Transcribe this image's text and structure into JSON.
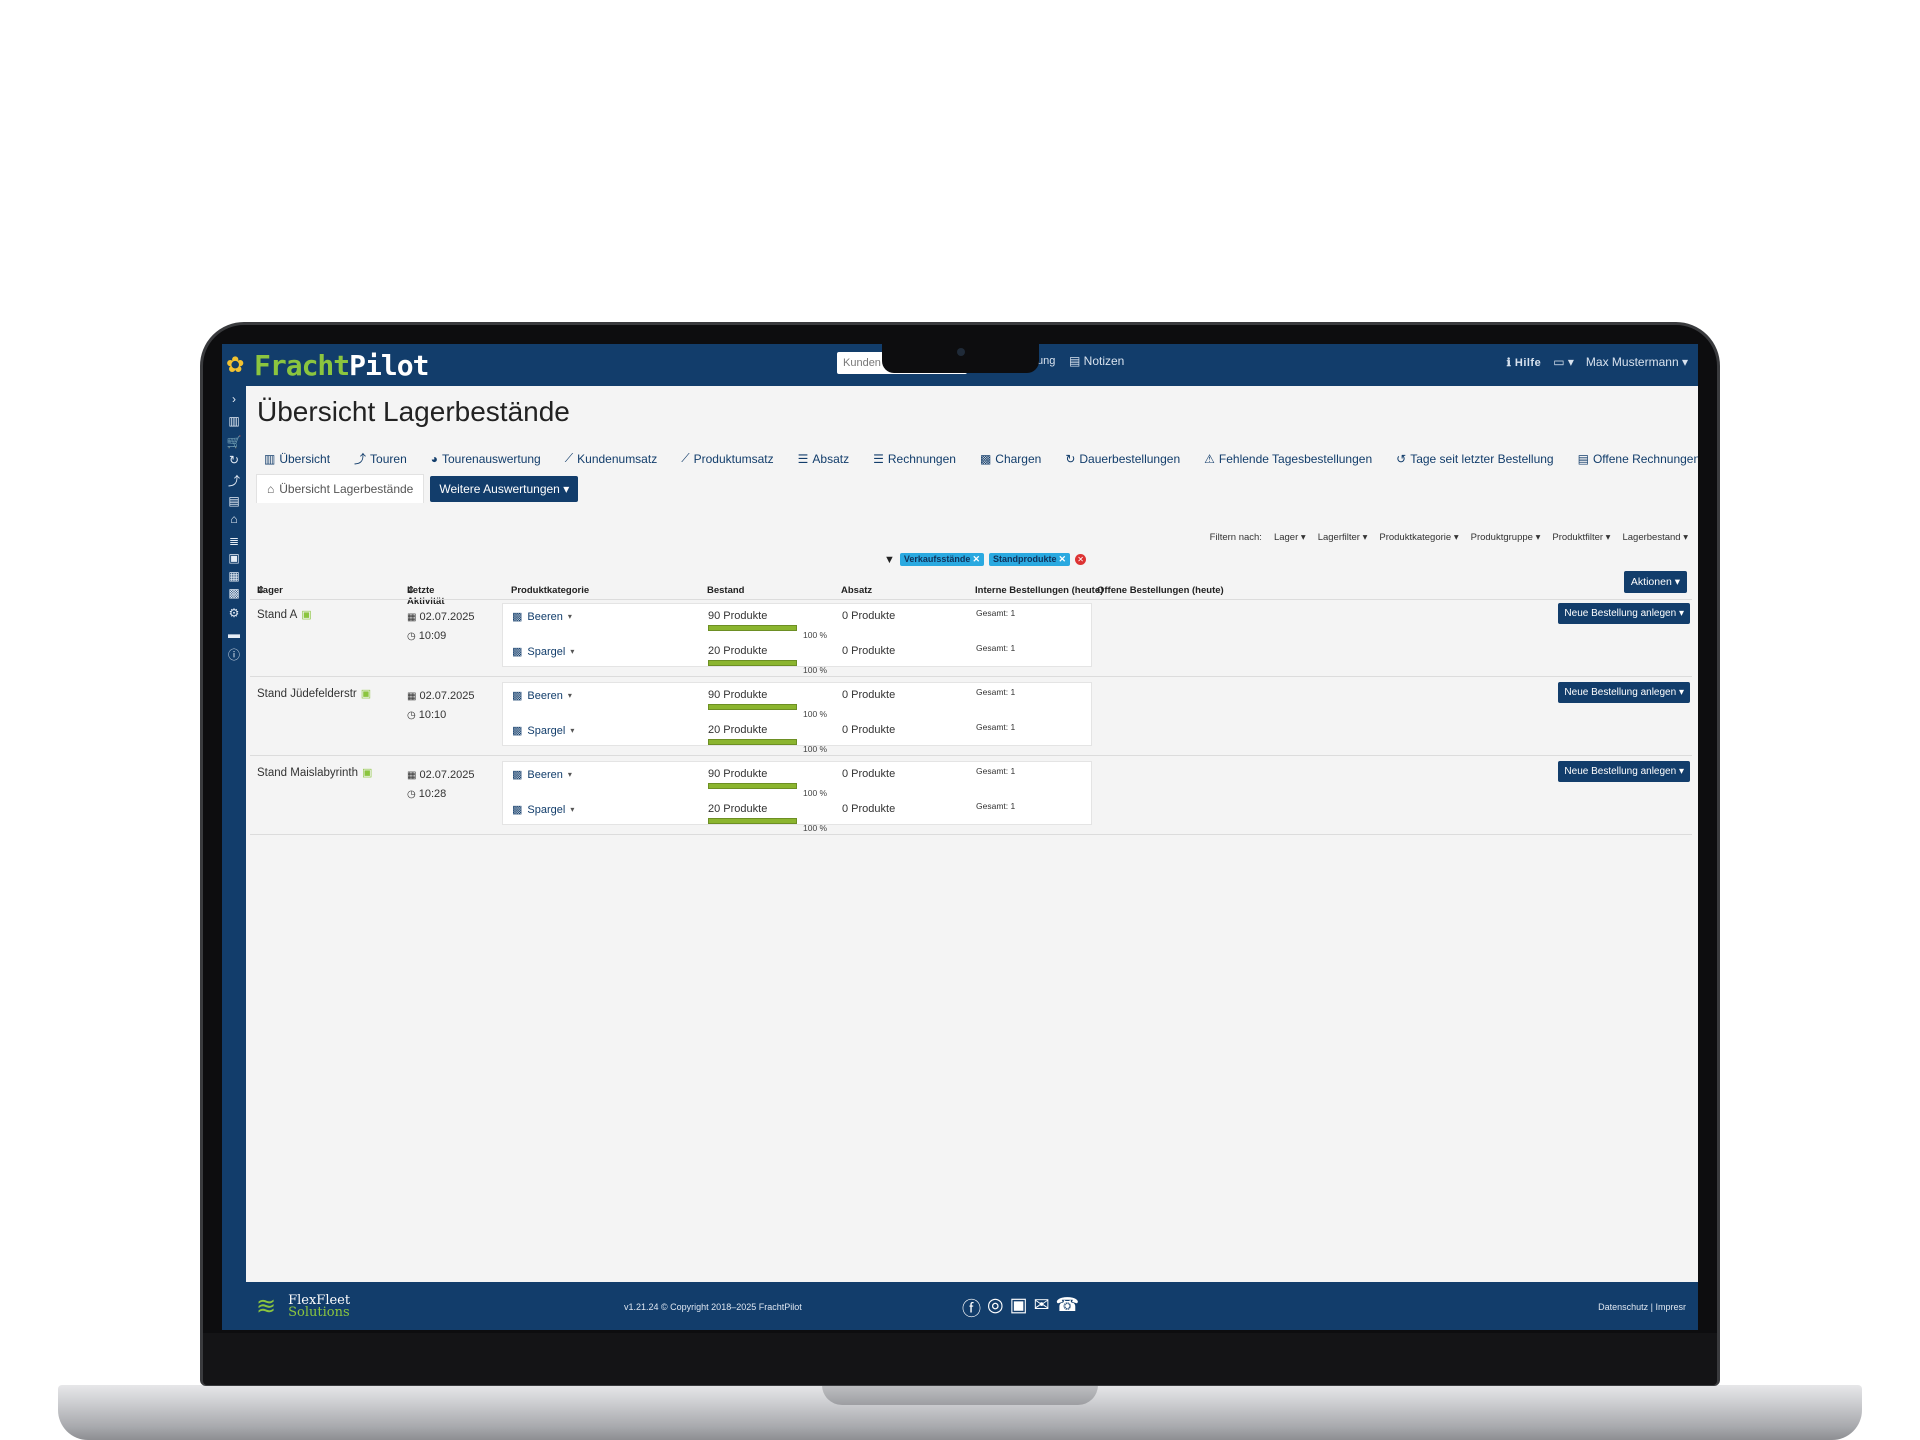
{
  "app": {
    "logo_part1": "Fracht",
    "logo_part2": "Pilot",
    "search_placeholder": "Kunden",
    "top_menu_tail": "ung",
    "notes_label": "Notizen",
    "help_label": "Hilfe",
    "user_name": "Max Mustermann"
  },
  "page": {
    "title": "Übersicht Lagerbestände"
  },
  "nav": {
    "items": [
      {
        "label": "Übersicht",
        "icon": "chart-icon"
      },
      {
        "label": "Touren",
        "icon": "route-icon"
      },
      {
        "label": "Tourenauswertung",
        "icon": "gauge-icon"
      },
      {
        "label": "Kundenumsatz",
        "icon": "line-chart-icon"
      },
      {
        "label": "Produktumsatz",
        "icon": "line-chart-icon"
      },
      {
        "label": "Absatz",
        "icon": "list-icon"
      },
      {
        "label": "Rechnungen",
        "icon": "invoice-icon"
      },
      {
        "label": "Chargen",
        "icon": "boxes-icon"
      },
      {
        "label": "Dauerbestellungen",
        "icon": "refresh-icon"
      },
      {
        "label": "Fehlende Tagesbestellungen",
        "icon": "warning-icon"
      },
      {
        "label": "Tage seit letzter Bestellung",
        "icon": "history-icon"
      },
      {
        "label": "Offene Rechnungen",
        "icon": "document-icon"
      }
    ],
    "active_tab": "Übersicht Lagerbestände",
    "more_button": "Weitere Auswertungen"
  },
  "filters": {
    "prefix": "Filtern nach:",
    "items": [
      "Lager",
      "Lagerfilter",
      "Produktkategorie",
      "Produktgruppe",
      "Produktfilter",
      "Lagerbestand"
    ],
    "active_chips": [
      "Verkaufsstände",
      "Standprodukte"
    ]
  },
  "actions_button": "Aktionen",
  "table": {
    "headers": {
      "lager": "Lager",
      "activity": "Letzte Aktivität",
      "category": "Produktkategorie",
      "stock": "Bestand",
      "sales": "Absatz",
      "internal_orders": "Interne Bestellungen (heute)",
      "open_orders": "Offene Bestellungen (heute)"
    },
    "new_order_button": "Neue Bestellung anlegen",
    "rows": [
      {
        "name": "Stand A",
        "date": "02.07.2025",
        "time": "10:09",
        "products": [
          {
            "category": "Beeren",
            "stock": "90 Produkte",
            "pct": "100 %",
            "fill": 1.0,
            "sales": "0 Produkte",
            "internal": "Gesamt: 1"
          },
          {
            "category": "Spargel",
            "stock": "20 Produkte",
            "pct": "100 %",
            "fill": 1.0,
            "sales": "0 Produkte",
            "internal": "Gesamt: 1"
          }
        ]
      },
      {
        "name": "Stand Jüdefelderstr",
        "date": "02.07.2025",
        "time": "10:10",
        "products": [
          {
            "category": "Beeren",
            "stock": "90 Produkte",
            "pct": "100 %",
            "fill": 1.0,
            "sales": "0 Produkte",
            "internal": "Gesamt: 1"
          },
          {
            "category": "Spargel",
            "stock": "20 Produkte",
            "pct": "100 %",
            "fill": 1.0,
            "sales": "0 Produkte",
            "internal": "Gesamt: 1"
          }
        ]
      },
      {
        "name": "Stand Maislabyrinth",
        "date": "02.07.2025",
        "time": "10:28",
        "products": [
          {
            "category": "Beeren",
            "stock": "90 Produkte",
            "pct": "100 %",
            "fill": 1.0,
            "sales": "0 Produkte",
            "internal": "Gesamt: 1"
          },
          {
            "category": "Spargel",
            "stock": "20 Produkte",
            "pct": "100 %",
            "fill": 1.0,
            "sales": "0 Produkte",
            "internal": "Gesamt: 1"
          }
        ]
      }
    ]
  },
  "footer": {
    "brand_line1": "FlexFleet",
    "brand_line2": "Solutions",
    "copyright": "v1.21.24 © Copyright 2018–2025 FrachtPilot",
    "links": "Datenschutz | Impresr"
  },
  "colors": {
    "primary": "#123d6b",
    "accent": "#8bc53f",
    "chip": "#2aa9e0"
  }
}
